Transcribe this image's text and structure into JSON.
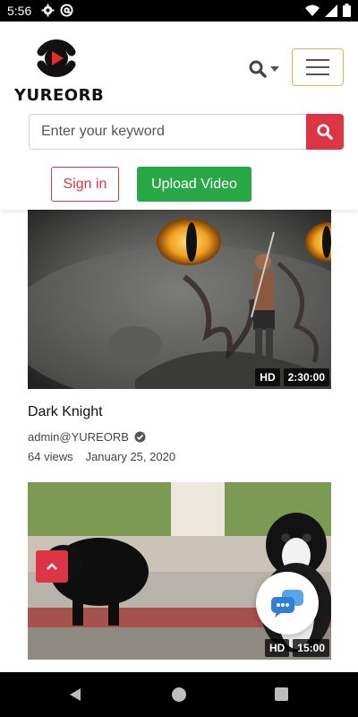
{
  "status_bar": {
    "time": "5:56",
    "left_icons": [
      "settings-icon",
      "at-sign-icon"
    ],
    "right_icons": [
      "wifi-icon",
      "signal-icon",
      "battery-icon"
    ]
  },
  "header": {
    "brand": "YUREORB",
    "brand_color": "#111111",
    "logo_accent": "#e52d27",
    "search_placeholder": "Enter your keyword",
    "search_value": "",
    "sign_in_label": "Sign in",
    "upload_label": "Upload Video",
    "accent_red": "#dc3545",
    "accent_green": "#28a745",
    "menu_border": "#f0ad4e"
  },
  "videos": [
    {
      "title": "Dark Knight",
      "channel": "admin@YUREORB",
      "verified": true,
      "views": "64 views",
      "date": "January 25, 2020",
      "quality": "HD",
      "duration": "2:30:00"
    },
    {
      "title": "",
      "channel": "",
      "quality": "HD",
      "duration": "15:00"
    }
  ],
  "floating": {
    "scroll_top_icon": "chevron-up-icon",
    "chat_icon": "chat-bubbles-icon"
  },
  "nav_bar": {
    "icons": [
      "back-icon",
      "home-icon",
      "recents-icon"
    ]
  }
}
